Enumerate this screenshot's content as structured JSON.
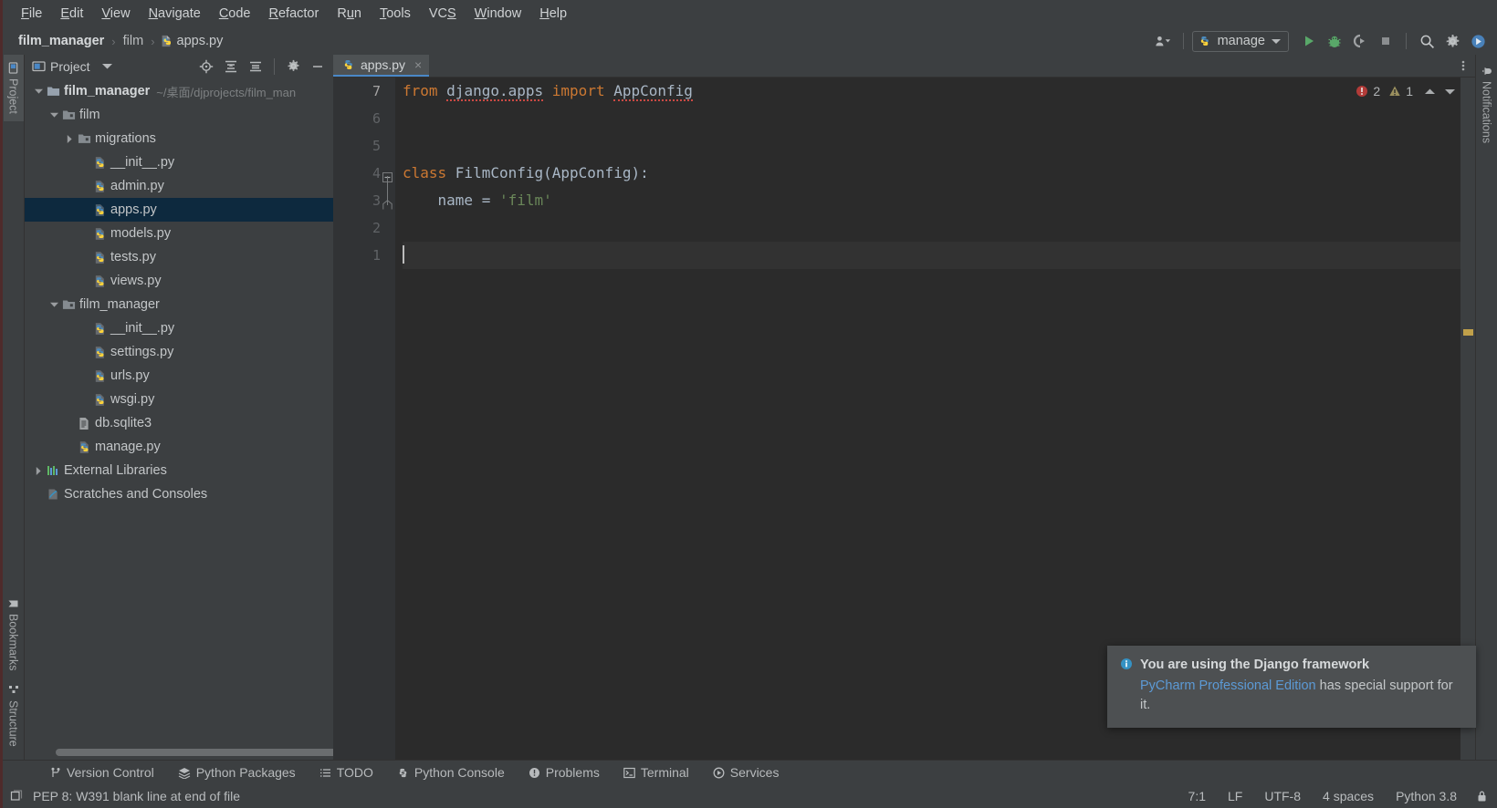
{
  "menu": {
    "items": [
      {
        "label": "File",
        "mnemonic": "F"
      },
      {
        "label": "Edit",
        "mnemonic": "E"
      },
      {
        "label": "View",
        "mnemonic": "V"
      },
      {
        "label": "Navigate",
        "mnemonic": "N"
      },
      {
        "label": "Code",
        "mnemonic": "C"
      },
      {
        "label": "Refactor",
        "mnemonic": "R"
      },
      {
        "label": "Run",
        "mnemonic": "u"
      },
      {
        "label": "Tools",
        "mnemonic": "T"
      },
      {
        "label": "VCS",
        "mnemonic": "S"
      },
      {
        "label": "Window",
        "mnemonic": "W"
      },
      {
        "label": "Help",
        "mnemonic": "H"
      }
    ]
  },
  "breadcrumb": {
    "project": "film_manager",
    "folder": "film",
    "file": "apps.py",
    "separator": "›"
  },
  "toolbar": {
    "run_config": "manage",
    "run_tooltip": "Run",
    "debug_tooltip": "Debug",
    "coverage_tooltip": "Run with Coverage",
    "stop_tooltip": "Stop",
    "search_tooltip": "Search Everywhere",
    "settings_tooltip": "Settings",
    "updates_tooltip": "Updates"
  },
  "left_strip": {
    "items": [
      {
        "label": "Project",
        "icon": "project-icon",
        "active": true
      },
      {
        "label": "Bookmarks",
        "icon": "bookmark-icon",
        "active": false
      },
      {
        "label": "Structure",
        "icon": "structure-icon",
        "active": false
      }
    ]
  },
  "right_strip": {
    "items": [
      {
        "label": "Notifications",
        "icon": "bell-icon"
      }
    ]
  },
  "project_panel": {
    "title": "Project",
    "tree": [
      {
        "depth": 0,
        "arrow": "down",
        "icon": "folder-icon",
        "label": "film_manager",
        "bold": true,
        "path": "~/桌面/djprojects/film_man",
        "selected": false
      },
      {
        "depth": 1,
        "arrow": "down",
        "icon": "module-folder-icon",
        "label": "film",
        "bold": false,
        "path": "",
        "selected": false
      },
      {
        "depth": 2,
        "arrow": "right",
        "icon": "module-folder-icon",
        "label": "migrations",
        "bold": false,
        "path": "",
        "selected": false
      },
      {
        "depth": 3,
        "arrow": "none",
        "icon": "python-file-icon",
        "label": "__init__.py",
        "bold": false,
        "path": "",
        "selected": false
      },
      {
        "depth": 3,
        "arrow": "none",
        "icon": "python-file-icon",
        "label": "admin.py",
        "bold": false,
        "path": "",
        "selected": false
      },
      {
        "depth": 3,
        "arrow": "none",
        "icon": "python-file-icon",
        "label": "apps.py",
        "bold": false,
        "path": "",
        "selected": true
      },
      {
        "depth": 3,
        "arrow": "none",
        "icon": "python-file-icon",
        "label": "models.py",
        "bold": false,
        "path": "",
        "selected": false
      },
      {
        "depth": 3,
        "arrow": "none",
        "icon": "python-file-icon",
        "label": "tests.py",
        "bold": false,
        "path": "",
        "selected": false
      },
      {
        "depth": 3,
        "arrow": "none",
        "icon": "python-file-icon",
        "label": "views.py",
        "bold": false,
        "path": "",
        "selected": false
      },
      {
        "depth": 1,
        "arrow": "down",
        "icon": "module-folder-icon",
        "label": "film_manager",
        "bold": false,
        "path": "",
        "selected": false
      },
      {
        "depth": 3,
        "arrow": "none",
        "icon": "python-file-icon",
        "label": "__init__.py",
        "bold": false,
        "path": "",
        "selected": false
      },
      {
        "depth": 3,
        "arrow": "none",
        "icon": "python-file-icon",
        "label": "settings.py",
        "bold": false,
        "path": "",
        "selected": false
      },
      {
        "depth": 3,
        "arrow": "none",
        "icon": "python-file-icon",
        "label": "urls.py",
        "bold": false,
        "path": "",
        "selected": false
      },
      {
        "depth": 3,
        "arrow": "none",
        "icon": "python-file-icon",
        "label": "wsgi.py",
        "bold": false,
        "path": "",
        "selected": false
      },
      {
        "depth": 2,
        "arrow": "none",
        "icon": "database-file-icon",
        "label": "db.sqlite3",
        "bold": false,
        "path": "",
        "selected": false
      },
      {
        "depth": 2,
        "arrow": "none",
        "icon": "python-file-icon",
        "label": "manage.py",
        "bold": false,
        "path": "",
        "selected": false
      },
      {
        "depth": 0,
        "arrow": "right",
        "icon": "library-icon",
        "label": "External Libraries",
        "bold": false,
        "path": "",
        "selected": false
      },
      {
        "depth": 0,
        "arrow": "none",
        "icon": "scratches-icon",
        "label": "Scratches and Consoles",
        "bold": false,
        "path": "",
        "selected": false
      }
    ]
  },
  "editor": {
    "tab": {
      "label": "apps.py",
      "icon": "python-file-icon",
      "close": "×"
    },
    "line_numbers": [
      "1",
      "2",
      "3",
      "4",
      "5",
      "6",
      "7"
    ],
    "current_line": 7,
    "code_lines": [
      {
        "n": 1,
        "tokens": [
          {
            "t": "from ",
            "c": "kw"
          },
          {
            "t": "django.apps",
            "c": "plain err"
          },
          {
            "t": " ",
            "c": "plain"
          },
          {
            "t": "import ",
            "c": "kw"
          },
          {
            "t": "AppConfig",
            "c": "plain err"
          }
        ]
      },
      {
        "n": 2,
        "tokens": []
      },
      {
        "n": 3,
        "tokens": []
      },
      {
        "n": 4,
        "tokens": [
          {
            "t": "class ",
            "c": "kw"
          },
          {
            "t": "FilmConfig(AppConfig):",
            "c": "plain"
          }
        ]
      },
      {
        "n": 5,
        "tokens": [
          {
            "t": "    name = ",
            "c": "plain"
          },
          {
            "t": "'film'",
            "c": "str"
          }
        ]
      },
      {
        "n": 6,
        "tokens": []
      },
      {
        "n": 7,
        "tokens": []
      }
    ],
    "inspections": {
      "error_count": "2",
      "warning_count": "1",
      "error_icon": "error-icon",
      "warning_icon": "warning-icon",
      "expand_icon": "chevron-up-icon",
      "more_icon": "chevron-down-icon"
    }
  },
  "notification": {
    "icon": "info-icon",
    "title": "You are using the Django framework",
    "link": "PyCharm Professional Edition",
    "body_rest": " has special support for it."
  },
  "tool_windows": {
    "items": [
      {
        "label": "Version Control",
        "icon": "branch-icon"
      },
      {
        "label": "Python Packages",
        "icon": "packages-icon"
      },
      {
        "label": "TODO",
        "icon": "todo-icon"
      },
      {
        "label": "Python Console",
        "icon": "python-console-icon"
      },
      {
        "label": "Problems",
        "icon": "problems-icon"
      },
      {
        "label": "Terminal",
        "icon": "terminal-icon"
      },
      {
        "label": "Services",
        "icon": "services-icon"
      }
    ]
  },
  "statusbar": {
    "message": "PEP 8: W391 blank line at end of file",
    "message_icon": "inspection-icon",
    "caret_position": "7:1",
    "line_separator": "LF",
    "encoding": "UTF-8",
    "indent": "4 spaces",
    "interpreter": "Python 3.8",
    "lock_icon": "lock-icon"
  },
  "colors": {
    "accent_blue": "#4a88c7",
    "selection_blue": "#0d293e",
    "keyword_orange": "#cc7832",
    "string_green": "#6a8759",
    "plain_text": "#a9b7c6",
    "editor_bg": "#2b2b2b",
    "panel_bg": "#3c3f41",
    "error_red": "#cc4a44",
    "link_blue": "#5c9ad6",
    "run_green": "#59a869"
  }
}
